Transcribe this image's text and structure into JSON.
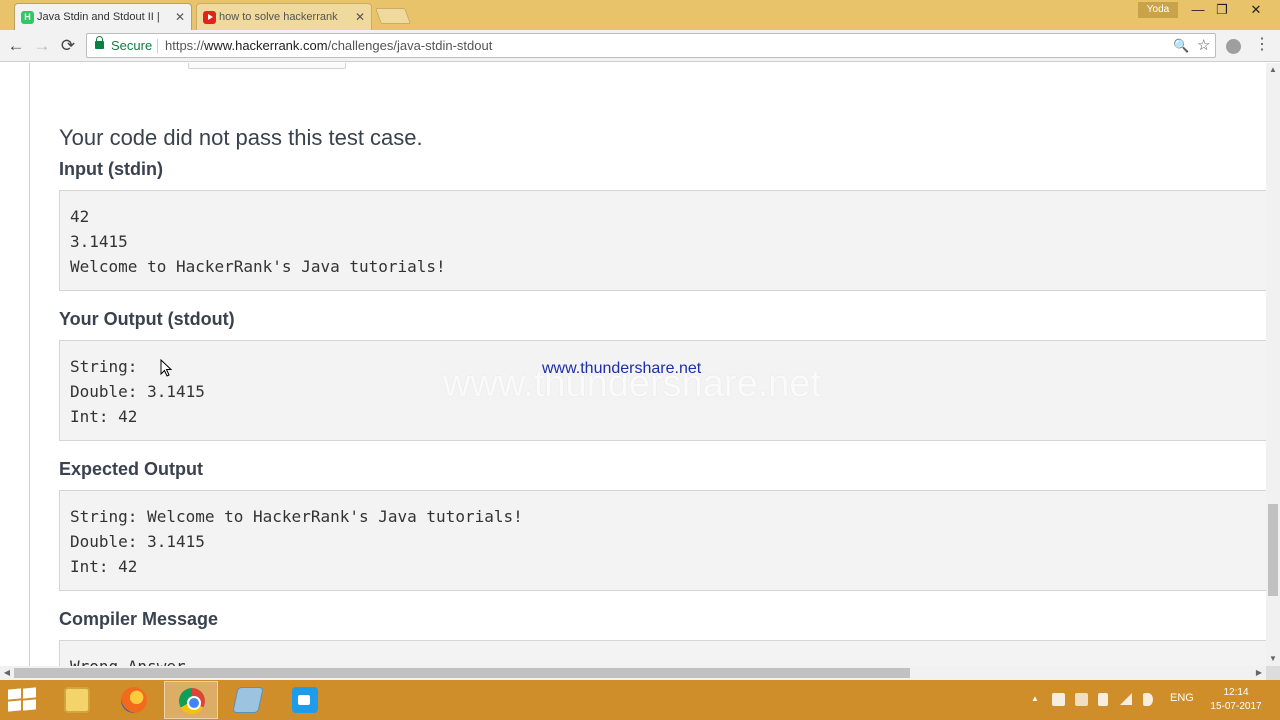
{
  "browser": {
    "tabs": [
      {
        "title": "Java Stdin and Stdout II |",
        "favicon": "hackerrank-icon",
        "active": true
      },
      {
        "title": "how to solve hackerrank",
        "favicon": "youtube-icon",
        "active": false
      }
    ],
    "window_user": "Yoda",
    "window_controls": {
      "minimize": "—",
      "restore": "❐",
      "close": "✕"
    },
    "nav": {
      "back": "←",
      "forward": "→",
      "reload": "⟳"
    },
    "address": {
      "secure_label": "Secure",
      "scheme": "https://",
      "host": "www.hackerrank.com",
      "path": "/challenges/java-stdin-stdout"
    },
    "omnibox_icons": {
      "zoom": "🔍",
      "bookmark": "☆"
    },
    "menu": "⋮"
  },
  "result": {
    "title": "Your code did not pass this test case.",
    "sections": [
      {
        "label": "Input (stdin)",
        "lines": [
          "42",
          "3.1415",
          "Welcome to HackerRank's Java tutorials!"
        ]
      },
      {
        "label": "Your Output (stdout)",
        "lines": [
          "String: ",
          "Double: 3.1415",
          "Int: 42"
        ]
      },
      {
        "label": "Expected Output",
        "lines": [
          "String: Welcome to HackerRank's Java tutorials!",
          "Double: 3.1415",
          "Int: 42"
        ]
      },
      {
        "label": "Compiler Message",
        "lines": [
          "Wrong Answer"
        ]
      }
    ]
  },
  "watermark": {
    "small": "www.thundershare.net",
    "large": "www.thundershare.net"
  },
  "taskbar": {
    "apps": [
      "file-explorer-icon",
      "firefox-icon",
      "chrome-icon",
      "notes-icon",
      "camera-icon"
    ],
    "language": "ENG",
    "time": "12:14",
    "date": "15-07-2017",
    "tray_arrow": "▲"
  },
  "colors": {
    "tabstrip": "#e8c36a",
    "taskbar": "#cf8e2a",
    "secure_green": "#0b8043",
    "heading": "#39424e"
  }
}
